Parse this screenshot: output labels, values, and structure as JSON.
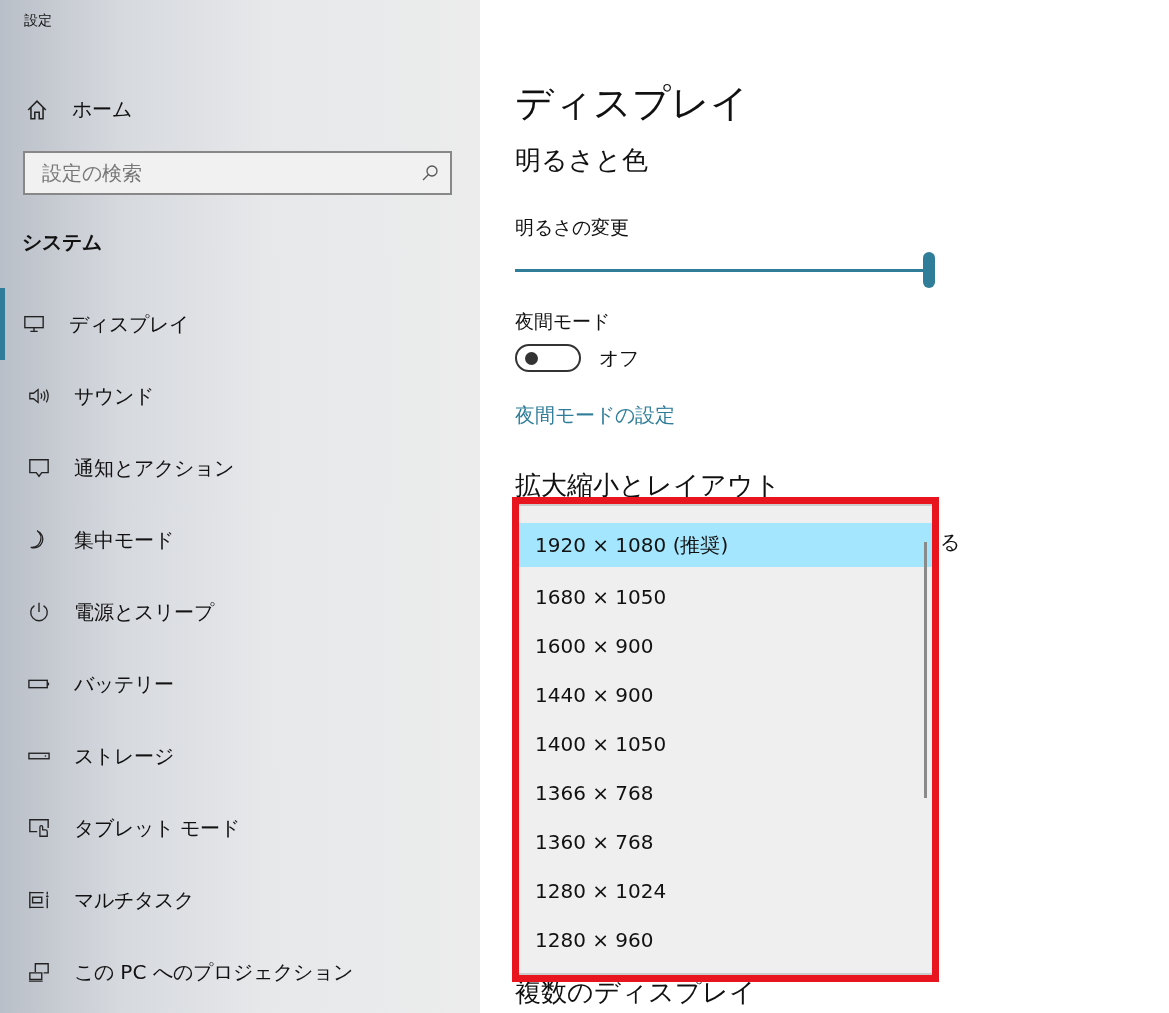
{
  "window": {
    "title": "設定"
  },
  "sidebar": {
    "home": "ホーム",
    "search": {
      "placeholder": "設定の検索"
    },
    "section": "システム",
    "items": [
      {
        "label": "ディスプレイ",
        "selected": true
      },
      {
        "label": "サウンド",
        "selected": false
      },
      {
        "label": "通知とアクション",
        "selected": false
      },
      {
        "label": "集中モード",
        "selected": false
      },
      {
        "label": "電源とスリープ",
        "selected": false
      },
      {
        "label": "バッテリー",
        "selected": false
      },
      {
        "label": "ストレージ",
        "selected": false
      },
      {
        "label": "タブレット モード",
        "selected": false
      },
      {
        "label": "マルチタスク",
        "selected": false
      },
      {
        "label": "この PC へのプロジェクション",
        "selected": false
      }
    ]
  },
  "page": {
    "title": "ディスプレイ",
    "section": "明るさと色",
    "brightness": {
      "label": "明るさの変更",
      "level": 1.0
    },
    "night_mode": {
      "label": "夜間モード",
      "on": false,
      "state": "オフ"
    },
    "night_link": "夜間モードの設定",
    "scale_heading": "拡大縮小とレイアウト",
    "hidden_line_end": "る",
    "multi_heading": "複数のディスプレイ"
  },
  "resolution_dropdown": {
    "options": [
      {
        "label": "1920 × 1080 (推奨)",
        "selected": true
      },
      {
        "label": "1680 × 1050",
        "selected": false
      },
      {
        "label": "1600 × 900",
        "selected": false
      },
      {
        "label": "1440 × 900",
        "selected": false
      },
      {
        "label": "1400 × 1050",
        "selected": false
      },
      {
        "label": "1366 × 768",
        "selected": false
      },
      {
        "label": "1360 × 768",
        "selected": false
      },
      {
        "label": "1280 × 1024",
        "selected": false
      },
      {
        "label": "1280 × 960",
        "selected": false
      }
    ]
  }
}
